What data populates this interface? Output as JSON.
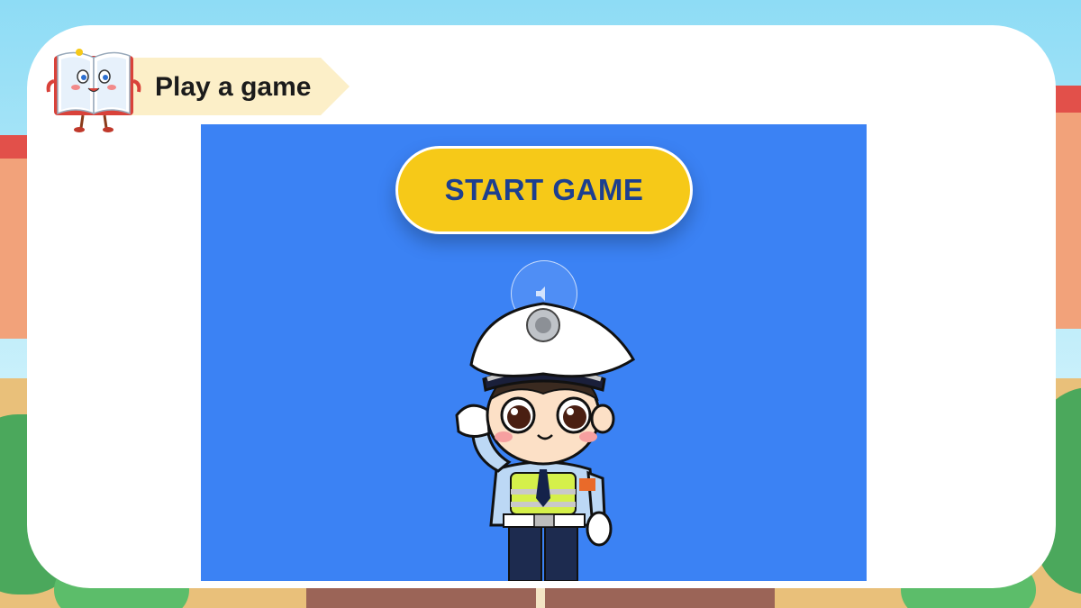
{
  "header": {
    "title": "Play a game",
    "mascot_icon": "book-mascot-icon"
  },
  "game": {
    "start_button_label": "START GAME",
    "sound_icon": "speaker-icon",
    "character": "police-officer-saluting"
  },
  "colors": {
    "game_background": "#3b82f4",
    "start_button": "#f6c918",
    "start_button_text": "#1d3f8f",
    "banner": "#fcefc8",
    "card": "#ffffff"
  }
}
